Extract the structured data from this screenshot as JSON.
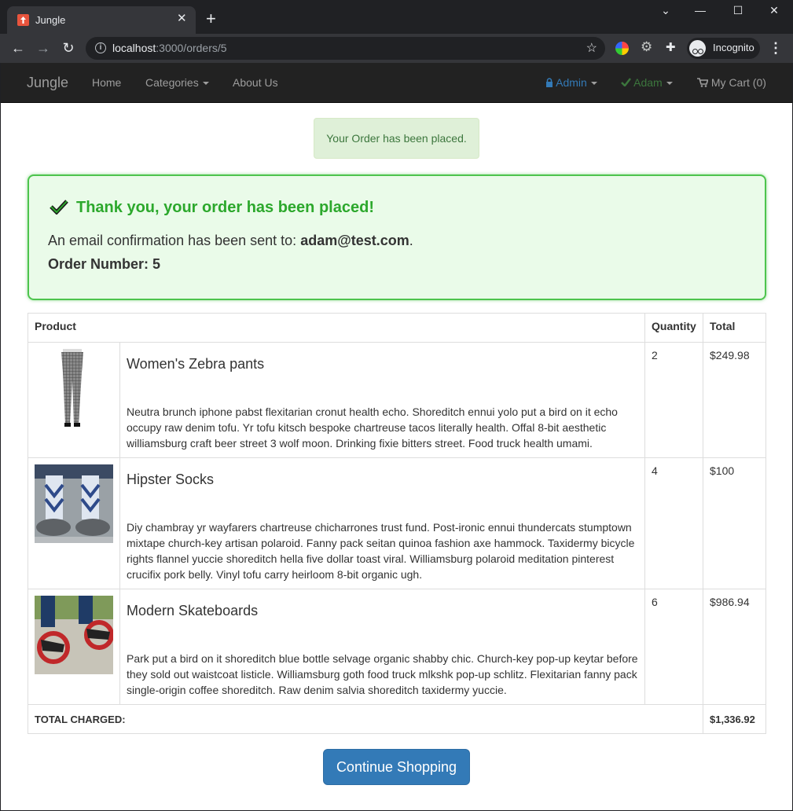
{
  "browser": {
    "tab_title": "Jungle",
    "tab_close": "✕",
    "new_tab": "+",
    "url_host": "localhost",
    "url_path": ":3000/orders/5",
    "profile_label": "Incognito",
    "window_controls": {
      "minimize": "—",
      "maximize": "☐",
      "close": "✕",
      "tab_search": "⌄"
    }
  },
  "navbar": {
    "brand": "Jungle",
    "home": "Home",
    "categories": "Categories",
    "about": "About Us",
    "admin": "Admin",
    "user": "Adam",
    "cart": "My Cart (0)"
  },
  "flash": {
    "message": "Your Order has been placed."
  },
  "confirmation": {
    "title": "Thank you, your order has been placed!",
    "email_prefix": "An email confirmation has been sent to: ",
    "email": "adam@test.com",
    "email_suffix": ".",
    "order_number_label": "Order Number: 5"
  },
  "table": {
    "headers": {
      "product": "Product",
      "quantity": "Quantity",
      "total": "Total"
    },
    "rows": [
      {
        "name": "Women's Zebra pants",
        "description": "Neutra brunch iphone pabst flexitarian cronut health echo. Shoreditch ennui yolo put a bird on it echo occupy raw denim tofu. Yr tofu kitsch bespoke chartreuse tacos literally health. Offal 8-bit aesthetic williamsburg craft beer street 3 wolf moon. Drinking fixie bitters street. Food truck health umami.",
        "quantity": "2",
        "total": "$249.98"
      },
      {
        "name": "Hipster Socks",
        "description": "Diy chambray yr wayfarers chartreuse chicharrones trust fund. Post-ironic ennui thundercats stumptown mixtape church-key artisan polaroid. Fanny pack seitan quinoa fashion axe hammock. Taxidermy bicycle rights flannel yuccie shoreditch hella five dollar toast viral. Williamsburg polaroid meditation pinterest crucifix pork belly. Vinyl tofu carry heirloom 8-bit organic ugh.",
        "quantity": "4",
        "total": "$100"
      },
      {
        "name": "Modern Skateboards",
        "description": "Park put a bird on it shoreditch blue bottle selvage organic shabby chic. Church-key pop-up keytar before they sold out waistcoat listicle. Williamsburg goth food truck mlkshk pop-up schlitz. Flexitarian fanny pack single-origin coffee shoreditch. Raw denim salvia shoreditch taxidermy yuccie.",
        "quantity": "6",
        "total": "$986.94"
      }
    ],
    "total_label": "TOTAL CHARGED:",
    "total_value": "$1,336.92"
  },
  "continue_button": "Continue Shopping",
  "colors": {
    "primary": "#337ab7",
    "success_text": "#2ca82c",
    "navbar_bg": "#222222"
  }
}
